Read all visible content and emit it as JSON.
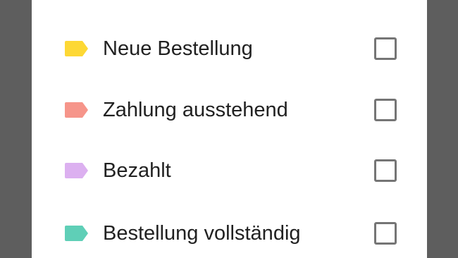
{
  "labels": [
    {
      "name": "Neue Bestellung",
      "color": "#fdd835",
      "checked": false,
      "icon": "label-tag-icon"
    },
    {
      "name": "Zahlung ausstehend",
      "color": "#f6958a",
      "checked": false,
      "icon": "label-tag-icon"
    },
    {
      "name": "Bezahlt",
      "color": "#dcb0f0",
      "checked": false,
      "icon": "label-tag-icon"
    },
    {
      "name": "Bestellung vollständig",
      "color": "#5fcfb7",
      "checked": false,
      "icon": "label-tag-icon"
    }
  ]
}
